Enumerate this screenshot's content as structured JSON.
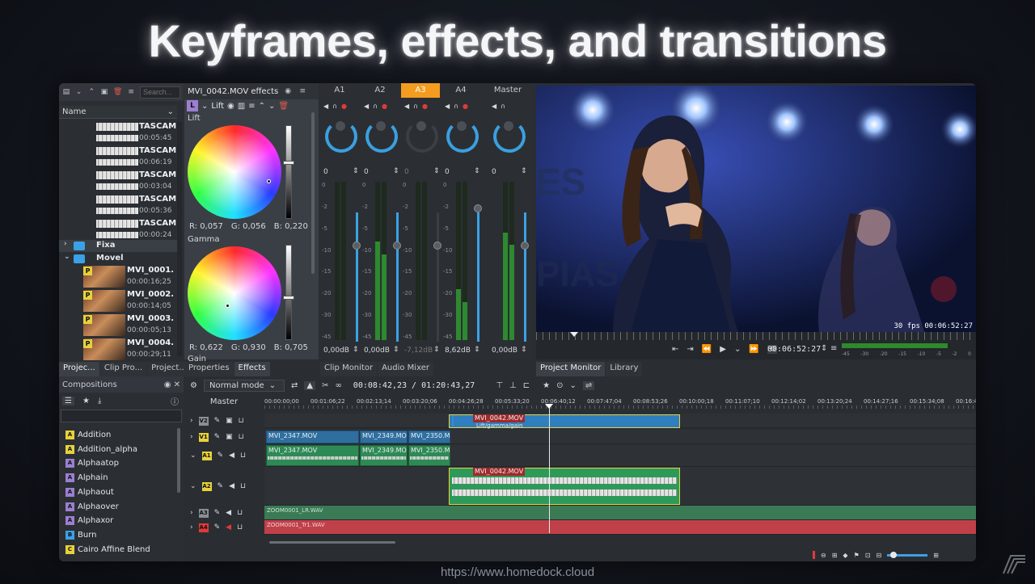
{
  "headline": "Keyframes, effects, and transitions",
  "footer_url": "https://www.homedock.cloud",
  "bin": {
    "search_placeholder": "Search...",
    "column_name": "Name",
    "audio_items": [
      {
        "name": "TASCAM",
        "duration": "00:05:45"
      },
      {
        "name": "TASCAM",
        "duration": "00:06:19"
      },
      {
        "name": "TASCAM",
        "duration": "00:03:04"
      },
      {
        "name": "TASCAM",
        "duration": "00:05:36"
      },
      {
        "name": "TASCAM",
        "duration": "00:00:24"
      }
    ],
    "folders": [
      "Fixa",
      "Movel"
    ],
    "video_items": [
      {
        "name": "MVI_0001.",
        "duration": "00:00:16;25"
      },
      {
        "name": "MVI_0002.",
        "duration": "00:00:14;05"
      },
      {
        "name": "MVI_0003.",
        "duration": "00:00:05;13"
      },
      {
        "name": "MVI_0004.",
        "duration": "00:00:29;11"
      }
    ],
    "tabs": [
      "Projec...",
      "Clip Pro...",
      "Project..."
    ]
  },
  "effects_panel": {
    "title": "MVI_0042.MOV effects",
    "effect_name": "Lift",
    "lift_label": "Lift",
    "lift_values": {
      "r": "R: 0,057",
      "g": "G: 0,056",
      "b": "B: 0,220"
    },
    "gamma_label": "Gamma",
    "gamma_values": {
      "r": "R: 0,622",
      "g": "G: 0,930",
      "b": "B: 0,705"
    },
    "gain_label": "Gain",
    "tabs": [
      "Properties",
      "Effects"
    ]
  },
  "mixer": {
    "channels": [
      "A1",
      "A2",
      "A3",
      "A4"
    ],
    "master": "Master",
    "active_channel": "A3",
    "gain_values": [
      "0",
      "0",
      "0",
      "0",
      "0"
    ],
    "db_values": [
      "0,00dB",
      "0,00dB",
      "-7,12dB",
      "8,62dB",
      "0,00dB"
    ],
    "scale": [
      "0",
      "-2",
      "-5",
      "-10",
      "-15",
      "-20",
      "-30",
      "-45"
    ],
    "meter_levels": [
      0.0,
      0.62,
      0.0,
      0.32,
      0.68
    ],
    "tabs": [
      "Clip Monitor",
      "Audio Mixer"
    ]
  },
  "monitor": {
    "fps": "30 fps 00:06:52:27",
    "timecode": "00:06:52:27",
    "tabs": [
      "Project Monitor",
      "Library"
    ],
    "vu_scale": [
      "-45",
      "-30",
      "-20",
      "-15",
      "-10",
      "-5",
      "-2",
      "0"
    ]
  },
  "compositions": {
    "title": "Compositions",
    "items": [
      {
        "badge": "A",
        "label": "Addition",
        "color": "#e7d23b"
      },
      {
        "badge": "A",
        "label": "Addition_alpha",
        "color": "#e7d23b"
      },
      {
        "badge": "A",
        "label": "Alphaatop",
        "color": "#9b7fd1"
      },
      {
        "badge": "A",
        "label": "Alphain",
        "color": "#9b7fd1"
      },
      {
        "badge": "A",
        "label": "Alphaout",
        "color": "#9b7fd1"
      },
      {
        "badge": "A",
        "label": "Alphaover",
        "color": "#9b7fd1"
      },
      {
        "badge": "A",
        "label": "Alphaxor",
        "color": "#9b7fd1"
      },
      {
        "badge": "B",
        "label": "Burn",
        "color": "#3ba1e6"
      },
      {
        "badge": "C",
        "label": "Cairo Affine Blend",
        "color": "#e7d23b"
      }
    ]
  },
  "timeline": {
    "mode": "Normal mode",
    "timecode": "00:08:42,23 / 01:20:43,27",
    "master": "Master",
    "ruler": [
      "00:00:00;00",
      "00:01:06;22",
      "00:02:13;14",
      "00:03:20;06",
      "00:04:26;28",
      "00:05:33;20",
      "00:06:40;12",
      "00:07:47;04",
      "00:08:53;26",
      "00:10:00;18",
      "00:11:07;10",
      "00:12:14;02",
      "00:13:20;24",
      "00:14:27;16",
      "00:15:34;08",
      "00:16:41"
    ],
    "tracks": [
      {
        "id": "V2",
        "color": "#8a8f96"
      },
      {
        "id": "V1",
        "color": "#e7d23b"
      },
      {
        "id": "A1",
        "color": "#e7d23b"
      },
      {
        "id": "A2",
        "color": "#e7d23b"
      },
      {
        "id": "A3",
        "color": "#8a8f96"
      },
      {
        "id": "A4",
        "color": "#e03a3a"
      }
    ],
    "clips": {
      "v2_clip": "MVI_0042.MOV",
      "v2_sub": "Lift/gamma/gain",
      "v1": [
        "MVI_2347.MOV",
        "MVI_2349.MOV",
        "MVI_2350.MOV"
      ],
      "a1": [
        "MVI_2347.MOV",
        "MVI_2349.MOV",
        "MVI_2350.MOV"
      ],
      "a2_clip": "MVI_0042.MOV",
      "a3_clip": "ZOOM0001_LR.WAV",
      "a4_clip": "ZOOM0001_Tr1.WAV"
    }
  }
}
